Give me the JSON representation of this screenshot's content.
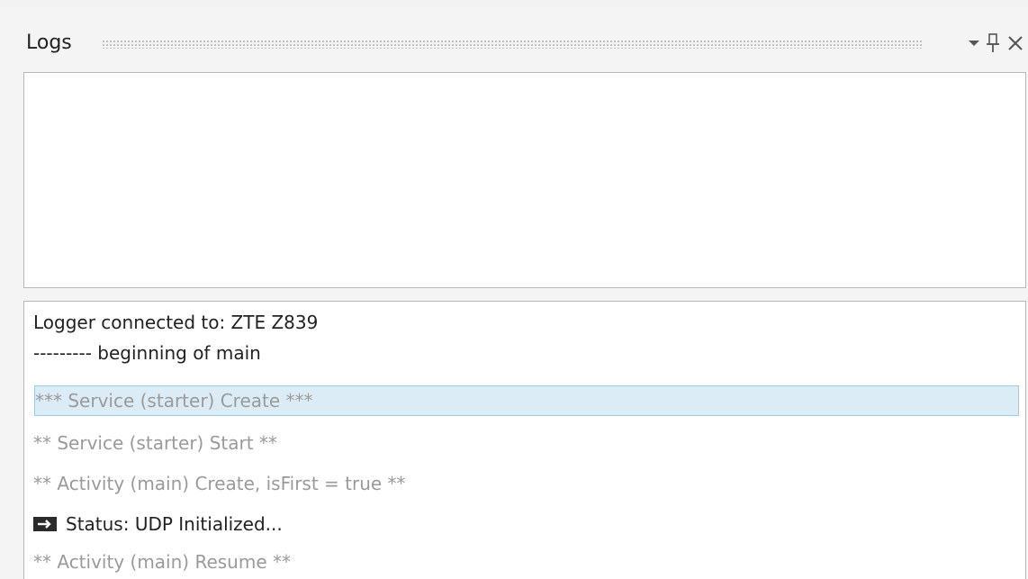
{
  "panel": {
    "title": "Logs",
    "buttons": {
      "dropdown_icon": "chevron-down-icon",
      "pin_icon": "pin-icon",
      "close_icon": "close-icon"
    }
  },
  "log": {
    "lines": [
      {
        "text": "Logger connected to:  ZTE Z839",
        "style": "dark"
      },
      {
        "text": "--------- beginning of main",
        "style": "dark"
      },
      {
        "text": "*** Service (starter) Create ***",
        "style": "gray",
        "selected": true
      },
      {
        "text": "** Service (starter) Start **",
        "style": "gray"
      },
      {
        "text": "** Activity (main) Create, isFirst = true **",
        "style": "gray"
      },
      {
        "text": "Status: UDP Initialized...",
        "style": "dark",
        "icon": "log-message-icon"
      },
      {
        "text": "** Activity (main) Resume **",
        "style": "gray"
      }
    ]
  },
  "colors": {
    "selection_fill": "#dcecf7",
    "selection_border": "#9ecbe6",
    "dim_text": "#9a9a9a",
    "normal_text": "#222222"
  }
}
